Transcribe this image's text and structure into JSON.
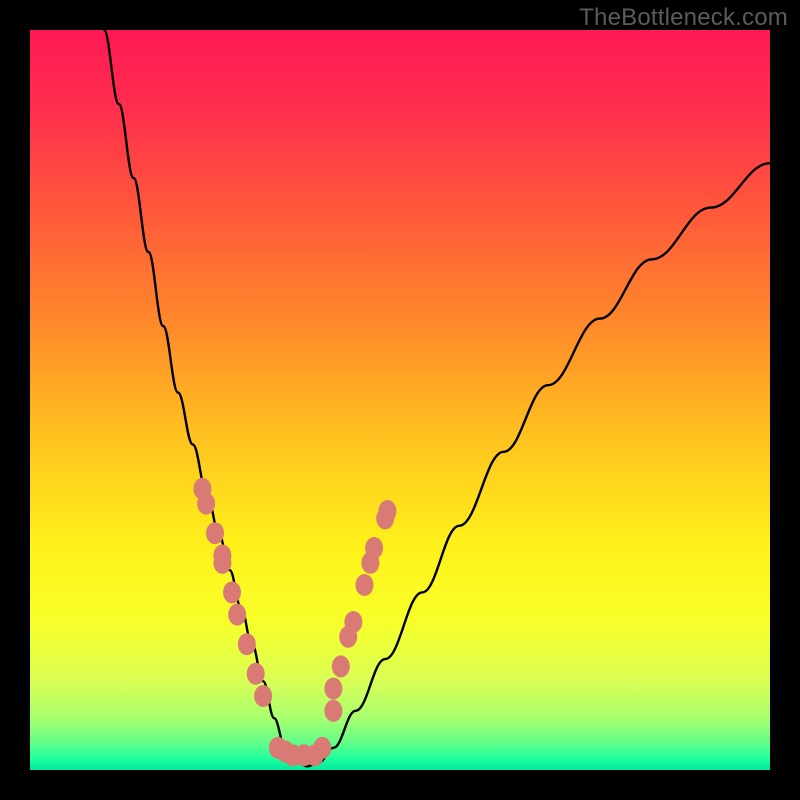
{
  "watermark": "TheBottleneck.com",
  "colors": {
    "frame": "#000000",
    "gradient_stops": [
      {
        "offset": 0.0,
        "color": "#ff1a55"
      },
      {
        "offset": 0.1,
        "color": "#ff2c4e"
      },
      {
        "offset": 0.25,
        "color": "#ff5a3a"
      },
      {
        "offset": 0.4,
        "color": "#ff8a2a"
      },
      {
        "offset": 0.55,
        "color": "#ffc21f"
      },
      {
        "offset": 0.7,
        "color": "#fff21a"
      },
      {
        "offset": 0.8,
        "color": "#f7ff2a"
      },
      {
        "offset": 0.88,
        "color": "#d9ff55"
      },
      {
        "offset": 0.93,
        "color": "#a8ff6e"
      },
      {
        "offset": 0.965,
        "color": "#5dff8a"
      },
      {
        "offset": 0.985,
        "color": "#1effa0"
      },
      {
        "offset": 1.0,
        "color": "#00e89a"
      }
    ],
    "curve": "#000000",
    "marker_fill": "#d97a74",
    "marker_stroke": "#b45c56"
  },
  "chart_data": {
    "type": "line",
    "title": "",
    "xlabel": "",
    "ylabel": "",
    "xlim": [
      0,
      100
    ],
    "ylim": [
      0,
      100
    ],
    "grid": false,
    "legend": false,
    "series": [
      {
        "name": "bottleneck-curve",
        "x": [
          10,
          12,
          14,
          16,
          18,
          20,
          22,
          24,
          25.5,
          27,
          28.5,
          30,
          31.5,
          33,
          34.5,
          36,
          37.5,
          39,
          41,
          44,
          48,
          53,
          58,
          64,
          70,
          77,
          84,
          92,
          100
        ],
        "y": [
          100,
          90,
          80,
          70,
          60,
          51,
          44,
          37,
          32,
          27,
          22,
          17,
          12,
          7,
          3,
          1,
          0.5,
          1,
          3,
          8,
          15,
          24,
          33,
          43,
          52,
          61,
          69,
          76,
          82
        ]
      }
    ],
    "marker_clusters": [
      {
        "name": "left-branch-markers",
        "points": [
          {
            "x": 23.3,
            "y": 38
          },
          {
            "x": 23.8,
            "y": 36
          },
          {
            "x": 25.0,
            "y": 32
          },
          {
            "x": 26.0,
            "y": 29
          },
          {
            "x": 26.0,
            "y": 28
          },
          {
            "x": 27.3,
            "y": 24
          },
          {
            "x": 28.0,
            "y": 21
          },
          {
            "x": 29.3,
            "y": 17
          },
          {
            "x": 30.5,
            "y": 13
          },
          {
            "x": 31.5,
            "y": 10
          }
        ]
      },
      {
        "name": "valley-markers",
        "points": [
          {
            "x": 33.5,
            "y": 3
          },
          {
            "x": 34.5,
            "y": 2.5
          },
          {
            "x": 35.5,
            "y": 2
          },
          {
            "x": 37.0,
            "y": 2
          },
          {
            "x": 38.5,
            "y": 2
          },
          {
            "x": 39.5,
            "y": 3
          }
        ]
      },
      {
        "name": "right-branch-markers",
        "points": [
          {
            "x": 41.0,
            "y": 8
          },
          {
            "x": 41.0,
            "y": 11
          },
          {
            "x": 42.0,
            "y": 14
          },
          {
            "x": 43.0,
            "y": 18
          },
          {
            "x": 43.7,
            "y": 20
          },
          {
            "x": 45.2,
            "y": 25
          },
          {
            "x": 46.0,
            "y": 28
          },
          {
            "x": 46.5,
            "y": 30
          },
          {
            "x": 48.0,
            "y": 34
          },
          {
            "x": 48.3,
            "y": 35
          }
        ]
      }
    ]
  }
}
